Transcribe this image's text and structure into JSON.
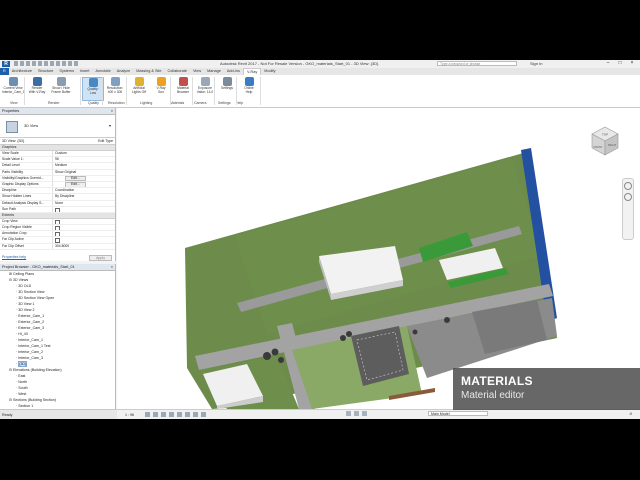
{
  "window": {
    "title": "Autodesk Revit 2017 - Not For Resale Version - GKO_materials_Start_01 - 3D View: {3D}",
    "search_placeholder": "Type a keyword or phrase",
    "sign_in": "Sign In",
    "logo": "R"
  },
  "tabs": [
    "Architecture",
    "Structure",
    "Systems",
    "Insert",
    "Annotate",
    "Analyze",
    "Massing & Site",
    "Collaborate",
    "View",
    "Manage",
    "Add-Ins",
    "V-Ray",
    "Modify"
  ],
  "active_tab": "V-Ray",
  "ribbon": {
    "buttons": [
      {
        "label": "Current View",
        "sub": "Interior_Cam_1",
        "icon": "camera-view-icon",
        "color": "#6a8fb3"
      },
      {
        "label": "Render",
        "sub": "With V-Ray",
        "icon": "render-teapot-icon",
        "color": "#3a6ea5"
      },
      {
        "label": "Show / Hide",
        "sub": "Frame Buffer",
        "icon": "frame-buffer-icon",
        "color": "#8a9cb0"
      },
      {
        "label": "Quality:",
        "sub": "Low",
        "icon": "quality-icon",
        "color": "#4a88c4"
      },
      {
        "label": "Resolution:",
        "sub": "400 x 300",
        "icon": "resolution-icon",
        "color": "#7fa0c0"
      },
      {
        "label": "Artificial",
        "sub": "Lights Off",
        "icon": "lightbulb-icon",
        "color": "#e0b030"
      },
      {
        "label": "V-Ray",
        "sub": "Sun",
        "icon": "sun-icon",
        "color": "#f0a020"
      },
      {
        "label": "Material",
        "sub": "Browser",
        "icon": "material-sphere-icon",
        "color": "#c0504d"
      },
      {
        "label": "Exposure",
        "sub": "Value: 14.0",
        "icon": "exposure-icon",
        "color": "#9aa7b5"
      },
      {
        "label": "Settings",
        "sub": "",
        "icon": "settings-icon",
        "color": "#7c8a99"
      },
      {
        "label": "Online",
        "sub": "Help",
        "icon": "help-icon",
        "color": "#3a7cc4"
      }
    ],
    "panels": [
      "View",
      "Render",
      "Quality",
      "Resolution",
      "Lighting",
      "Materials",
      "Camera",
      "Settings",
      "Help"
    ]
  },
  "properties": {
    "header": "Properties",
    "type_name": "3D View",
    "view_selector": "3D View: {3D}",
    "edit_type": "Edit Type",
    "sections": {
      "graphics": "Graphics",
      "extents": "Extents"
    },
    "graphics_rows": [
      {
        "k": "View Scale",
        "v": "Custom"
      },
      {
        "k": "Scale Value    1:",
        "v": "96"
      },
      {
        "k": "Detail Level",
        "v": "Medium"
      },
      {
        "k": "Parts Visibility",
        "v": "Show Original"
      },
      {
        "k": "Visibility/Graphics Overrid...",
        "v": "Edit..."
      },
      {
        "k": "Graphic Display Options",
        "v": "Edit..."
      },
      {
        "k": "Discipline",
        "v": "Coordination"
      },
      {
        "k": "Show Hidden Lines",
        "v": "By Discipline"
      },
      {
        "k": "Default Analysis Display S...",
        "v": "None"
      },
      {
        "k": "Sun Path",
        "v": ""
      }
    ],
    "extents_rows": [
      {
        "k": "Crop View",
        "v": ""
      },
      {
        "k": "Crop Region Visible",
        "v": ""
      },
      {
        "k": "Annotation Crop",
        "v": ""
      },
      {
        "k": "Far Clip Active",
        "v": ""
      },
      {
        "k": "Far Clip Offset",
        "v": "304.8000"
      }
    ],
    "help_link": "Properties help",
    "apply": "Apply"
  },
  "browser": {
    "header": "Project Browser - GKO_materials_Start_01",
    "items": [
      {
        "label": "Ceiling Plans",
        "indent": 1,
        "toggle": "+"
      },
      {
        "label": "3D Views",
        "indent": 1,
        "toggle": "-"
      },
      {
        "label": "3D OLD",
        "indent": 2,
        "toggle": ""
      },
      {
        "label": "3D Section View",
        "indent": 2,
        "toggle": ""
      },
      {
        "label": "3D Section View Open",
        "indent": 2,
        "toggle": ""
      },
      {
        "label": "3D View 1",
        "indent": 2,
        "toggle": ""
      },
      {
        "label": "3D View 2",
        "indent": 2,
        "toggle": ""
      },
      {
        "label": "Exterior_Cam_1",
        "indent": 2,
        "toggle": ""
      },
      {
        "label": "Exterior_Cam_2",
        "indent": 2,
        "toggle": ""
      },
      {
        "label": "Exterior_Cam_3",
        "indent": 2,
        "toggle": ""
      },
      {
        "label": "HI_4X",
        "indent": 2,
        "toggle": ""
      },
      {
        "label": "Interior_Cam_1",
        "indent": 2,
        "toggle": ""
      },
      {
        "label": "Interior_Cam_1 Test",
        "indent": 2,
        "toggle": ""
      },
      {
        "label": "Interior_Cam_2",
        "indent": 2,
        "toggle": ""
      },
      {
        "label": "Interior_Cam_3",
        "indent": 2,
        "toggle": ""
      },
      {
        "label": "{3D}",
        "indent": 2,
        "toggle": "",
        "selected": true
      },
      {
        "label": "Elevations (Building Elevation)",
        "indent": 1,
        "toggle": "-"
      },
      {
        "label": "East",
        "indent": 2,
        "toggle": ""
      },
      {
        "label": "North",
        "indent": 2,
        "toggle": ""
      },
      {
        "label": "South",
        "indent": 2,
        "toggle": ""
      },
      {
        "label": "West",
        "indent": 2,
        "toggle": ""
      },
      {
        "label": "Sections (Building Section)",
        "indent": 1,
        "toggle": "-"
      },
      {
        "label": "Section 1",
        "indent": 2,
        "toggle": ""
      }
    ]
  },
  "viewcube": {
    "top": "TOP",
    "front": "FRONT",
    "right": "RIGHT"
  },
  "viewbar": {
    "scale": "1 : 96"
  },
  "status": {
    "ready": "Ready",
    "model": "Main Model",
    "filter": ":0"
  },
  "overlay": {
    "title": "MATERIALS",
    "subtitle": "Material editor"
  },
  "colors": {
    "ground": "#6a8a4a",
    "road": "#9a9a9a",
    "building": "#f0f0f0",
    "lawn": "#3a9a3a",
    "accent": "#1d5fa8"
  }
}
